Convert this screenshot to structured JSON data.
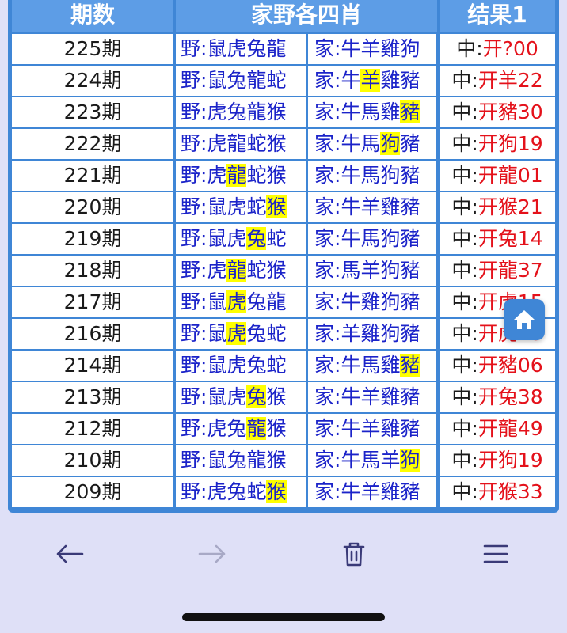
{
  "headers": {
    "period": "期数",
    "animals": "家野各四肖",
    "result": "结果1"
  },
  "rows": [
    {
      "period": "225期",
      "wild_prefix": "野:",
      "wild": [
        "鼠",
        "虎",
        "兔",
        "龍"
      ],
      "wild_hl": -1,
      "home_prefix": "家:",
      "home": [
        "牛",
        "羊",
        "雞",
        "狗"
      ],
      "home_hl": -1,
      "result_prefix": "中:",
      "result_value": "开?00"
    },
    {
      "period": "224期",
      "wild_prefix": "野:",
      "wild": [
        "鼠",
        "兔",
        "龍",
        "蛇"
      ],
      "wild_hl": -1,
      "home_prefix": "家:",
      "home": [
        "牛",
        "羊",
        "雞",
        "豬"
      ],
      "home_hl": 1,
      "result_prefix": "中:",
      "result_value": "开羊22"
    },
    {
      "period": "223期",
      "wild_prefix": "野:",
      "wild": [
        "虎",
        "兔",
        "龍",
        "猴"
      ],
      "wild_hl": -1,
      "home_prefix": "家:",
      "home": [
        "牛",
        "馬",
        "雞",
        "豬"
      ],
      "home_hl": 3,
      "result_prefix": "中:",
      "result_value": "开豬30"
    },
    {
      "period": "222期",
      "wild_prefix": "野:",
      "wild": [
        "虎",
        "龍",
        "蛇",
        "猴"
      ],
      "wild_hl": -1,
      "home_prefix": "家:",
      "home": [
        "牛",
        "馬",
        "狗",
        "豬"
      ],
      "home_hl": 2,
      "result_prefix": "中:",
      "result_value": "开狗19"
    },
    {
      "period": "221期",
      "wild_prefix": "野:",
      "wild": [
        "虎",
        "龍",
        "蛇",
        "猴"
      ],
      "wild_hl": 1,
      "home_prefix": "家:",
      "home": [
        "牛",
        "馬",
        "狗",
        "豬"
      ],
      "home_hl": -1,
      "result_prefix": "中:",
      "result_value": "开龍01"
    },
    {
      "period": "220期",
      "wild_prefix": "野:",
      "wild": [
        "鼠",
        "虎",
        "蛇",
        "猴"
      ],
      "wild_hl": 3,
      "home_prefix": "家:",
      "home": [
        "牛",
        "羊",
        "雞",
        "豬"
      ],
      "home_hl": -1,
      "result_prefix": "中:",
      "result_value": "开猴21"
    },
    {
      "period": "219期",
      "wild_prefix": "野:",
      "wild": [
        "鼠",
        "虎",
        "兔",
        "蛇"
      ],
      "wild_hl": 2,
      "home_prefix": "家:",
      "home": [
        "牛",
        "馬",
        "狗",
        "豬"
      ],
      "home_hl": -1,
      "result_prefix": "中:",
      "result_value": "开兔14"
    },
    {
      "period": "218期",
      "wild_prefix": "野:",
      "wild": [
        "虎",
        "龍",
        "蛇",
        "猴"
      ],
      "wild_hl": 1,
      "home_prefix": "家:",
      "home": [
        "馬",
        "羊",
        "狗",
        "豬"
      ],
      "home_hl": -1,
      "result_prefix": "中:",
      "result_value": "开龍37"
    },
    {
      "period": "217期",
      "wild_prefix": "野:",
      "wild": [
        "鼠",
        "虎",
        "兔",
        "龍"
      ],
      "wild_hl": 1,
      "home_prefix": "家:",
      "home": [
        "牛",
        "雞",
        "狗",
        "豬"
      ],
      "home_hl": -1,
      "result_prefix": "中:",
      "result_value": "开虎15"
    },
    {
      "period": "216期",
      "wild_prefix": "野:",
      "wild": [
        "鼠",
        "虎",
        "兔",
        "蛇"
      ],
      "wild_hl": 1,
      "home_prefix": "家:",
      "home": [
        "羊",
        "雞",
        "狗",
        "豬"
      ],
      "home_hl": -1,
      "result_prefix": "中:",
      "result_value": "开虎15"
    },
    {
      "period": "214期",
      "wild_prefix": "野:",
      "wild": [
        "鼠",
        "虎",
        "兔",
        "蛇"
      ],
      "wild_hl": -1,
      "home_prefix": "家:",
      "home": [
        "牛",
        "馬",
        "雞",
        "豬"
      ],
      "home_hl": 3,
      "result_prefix": "中:",
      "result_value": "开豬06"
    },
    {
      "period": "213期",
      "wild_prefix": "野:",
      "wild": [
        "鼠",
        "虎",
        "兔",
        "猴"
      ],
      "wild_hl": 2,
      "home_prefix": "家:",
      "home": [
        "牛",
        "羊",
        "雞",
        "豬"
      ],
      "home_hl": -1,
      "result_prefix": "中:",
      "result_value": "开兔38"
    },
    {
      "period": "212期",
      "wild_prefix": "野:",
      "wild": [
        "虎",
        "兔",
        "龍",
        "猴"
      ],
      "wild_hl": 2,
      "home_prefix": "家:",
      "home": [
        "牛",
        "羊",
        "雞",
        "豬"
      ],
      "home_hl": -1,
      "result_prefix": "中:",
      "result_value": "开龍49"
    },
    {
      "period": "210期",
      "wild_prefix": "野:",
      "wild": [
        "鼠",
        "兔",
        "龍",
        "猴"
      ],
      "wild_hl": -1,
      "home_prefix": "家:",
      "home": [
        "牛",
        "馬",
        "羊",
        "狗"
      ],
      "home_hl": 3,
      "result_prefix": "中:",
      "result_value": "开狗19"
    },
    {
      "period": "209期",
      "wild_prefix": "野:",
      "wild": [
        "虎",
        "兔",
        "蛇",
        "猴"
      ],
      "wild_hl": 3,
      "home_prefix": "家:",
      "home": [
        "牛",
        "羊",
        "雞",
        "豬"
      ],
      "home_hl": -1,
      "result_prefix": "中:",
      "result_value": "开猴33"
    }
  ],
  "icons": {
    "home_button": "home-icon",
    "back": "arrow-left-icon",
    "forward": "arrow-right-icon",
    "delete": "trash-icon",
    "menu": "menu-icon"
  },
  "colors": {
    "frame": "#3f86d6",
    "header": "#5d9de6",
    "animal_text": "#1b23c9",
    "result_text": "#e4111a",
    "highlight": "#ffff00",
    "navbar": "#dfe0f7"
  }
}
